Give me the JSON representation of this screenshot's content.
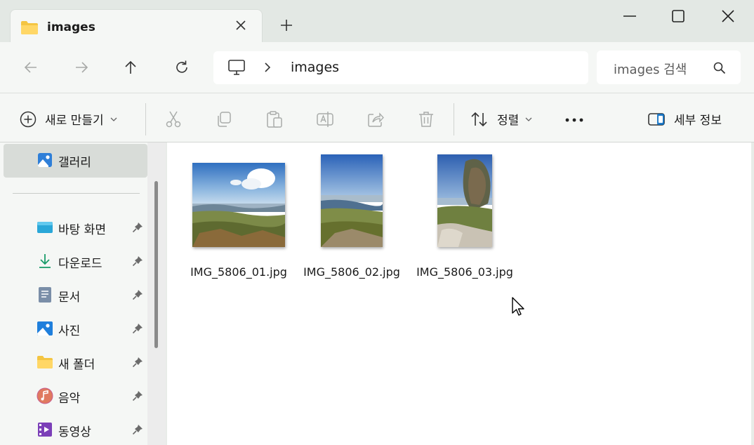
{
  "window": {
    "tab_title": "images",
    "tab_icon": "folder-icon",
    "controls": [
      "minimize-icon",
      "maximize-icon",
      "close-icon"
    ]
  },
  "navigation": {
    "breadcrumb_current": "images",
    "search_placeholder": "images 검색"
  },
  "toolbar": {
    "new_label": "새로 만들기",
    "sort_label": "정렬",
    "details_label": "세부 정보",
    "more_label": "•••"
  },
  "sidebar": {
    "selected": "갤러리",
    "items": [
      {
        "label": "갤러리",
        "icon": "gallery-icon"
      },
      {
        "label": "바탕 화면",
        "icon": "desktop-icon",
        "pinned": true
      },
      {
        "label": "다운로드",
        "icon": "download-icon",
        "pinned": true
      },
      {
        "label": "문서",
        "icon": "document-icon",
        "pinned": true
      },
      {
        "label": "사진",
        "icon": "pictures-icon",
        "pinned": true
      },
      {
        "label": "새 폴더",
        "icon": "folder-icon",
        "pinned": true
      },
      {
        "label": "음악",
        "icon": "music-icon",
        "pinned": true
      },
      {
        "label": "동영상",
        "icon": "video-icon",
        "pinned": true
      }
    ]
  },
  "files": [
    {
      "name": "IMG_5806_01.jpg"
    },
    {
      "name": "IMG_5806_02.jpg"
    },
    {
      "name": "IMG_5806_03.jpg"
    }
  ],
  "colors": {
    "accent": "#0067c0",
    "selection": "#d8dcd8",
    "folder": "#f4c542"
  }
}
